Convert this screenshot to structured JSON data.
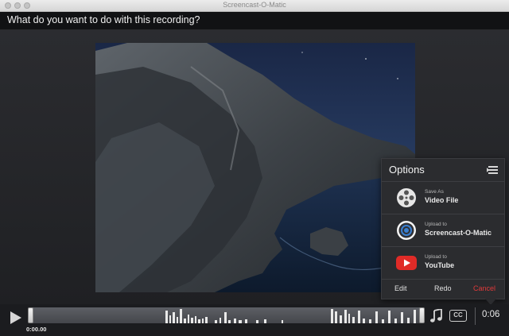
{
  "window": {
    "title": "Screencast-O-Matic"
  },
  "header": {
    "question": "What do you want to do with this recording?"
  },
  "options_panel": {
    "title": "Options",
    "items": [
      {
        "small": "Save As",
        "big": "Video File",
        "icon": "film-reel-icon"
      },
      {
        "small": "Upload to",
        "big": "Screencast-O-Matic",
        "icon": "screencast-logo-icon"
      },
      {
        "small": "Upload to",
        "big": "YouTube",
        "icon": "youtube-icon"
      }
    ],
    "actions": {
      "edit": "Edit",
      "redo": "Redo",
      "cancel": "Cancel"
    }
  },
  "timeline": {
    "current_time": "0:00.00",
    "duration": "0:06",
    "cc_label": "CC",
    "icons": [
      "play-icon",
      "music-note-icon",
      "closed-captions-icon"
    ]
  },
  "colors": {
    "accent": "#e03a3a",
    "youtube_red": "#e02b27",
    "background": "#1c1d20"
  }
}
